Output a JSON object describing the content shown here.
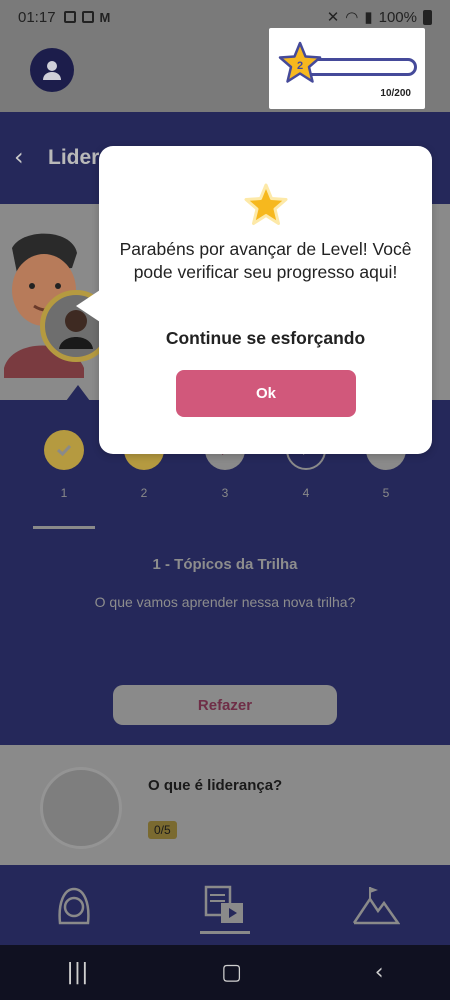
{
  "status_bar": {
    "time": "01:17",
    "battery": "100%"
  },
  "progress": {
    "level": "2",
    "counter": "10/200",
    "fraction": 0.05
  },
  "header": {
    "title": "Lider"
  },
  "steps": [
    {
      "num": "1",
      "state": "done"
    },
    {
      "num": "2",
      "state": "locked"
    },
    {
      "num": "3",
      "state": "video"
    },
    {
      "num": "4",
      "state": "video"
    },
    {
      "num": "5",
      "state": "chat"
    }
  ],
  "section": {
    "title": "1 - Tópicos da Trilha",
    "description": "O que vamos aprender nessa nova trilha?",
    "redo_label": "Refazer"
  },
  "topic": {
    "title": "O que é liderança?",
    "badge": "0/5"
  },
  "modal": {
    "message": "Parabéns por avançar de Level! Você pode verificar seu progresso aqui!",
    "continue": "Continue se esforçando",
    "ok_label": "Ok"
  },
  "colors": {
    "primary": "#454a9a",
    "accent": "#d1587b",
    "star": "#f6b81e",
    "navy": "#25285a"
  }
}
